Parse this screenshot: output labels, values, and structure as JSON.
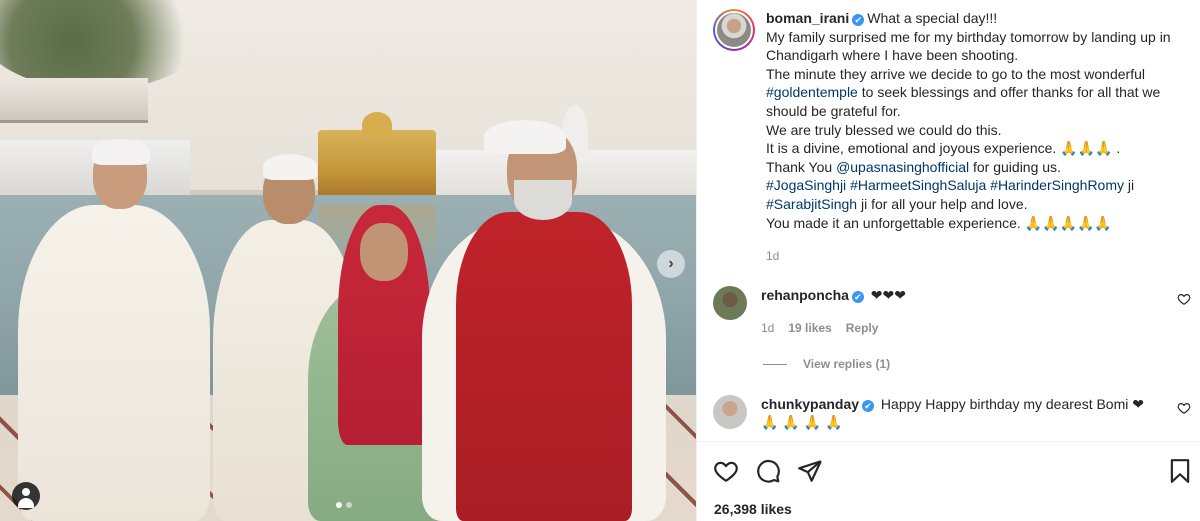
{
  "post": {
    "username": "boman_irani",
    "verified_mark": "✔",
    "caption_lines": [
      "What a special day!!!",
      "My family surprised me for my birthday tomorrow by landing up in Chandigarh where I have been shooting.",
      "The minute they arrive we decide to go to the most wonderful",
      "#goldentemple",
      " to seek blessings and offer thanks for all that we should be grateful for.",
      "We are truly blessed we could do this.",
      "It is a divine, emotional and joyous experience. 🙏🙏🙏 .",
      "Thank You ",
      "@upasnasinghofficial",
      " for guiding us.",
      "#JogaSinghji",
      "#HarmeetSinghSaluja",
      "#HarinderSinghRomy",
      " ji",
      "#SarabjitSingh",
      " ji for all your help and love.",
      "You made it an unforgettable experience. 🙏🙏🙏🙏🙏"
    ],
    "time": "1d",
    "likes": "26,398 likes"
  },
  "comments": [
    {
      "username": "rehanponcha",
      "text": "❤❤❤",
      "time": "1d",
      "likes": "19 likes",
      "reply": "Reply",
      "view_replies": "View replies (1)"
    },
    {
      "username": "chunkypanday",
      "text": "Happy Happy birthday my dearest Bomi ❤ 🙏 🙏 🙏 🙏"
    }
  ],
  "photo": {
    "next_arrow": "›"
  },
  "icons": {
    "like": "heart-icon",
    "comment": "comment-icon",
    "share": "send-icon",
    "save": "bookmark-icon",
    "tag": "user-tag-icon"
  },
  "colors": {
    "verified": "#3897f0",
    "link": "#00376b",
    "muted": "#8e8e8e"
  }
}
